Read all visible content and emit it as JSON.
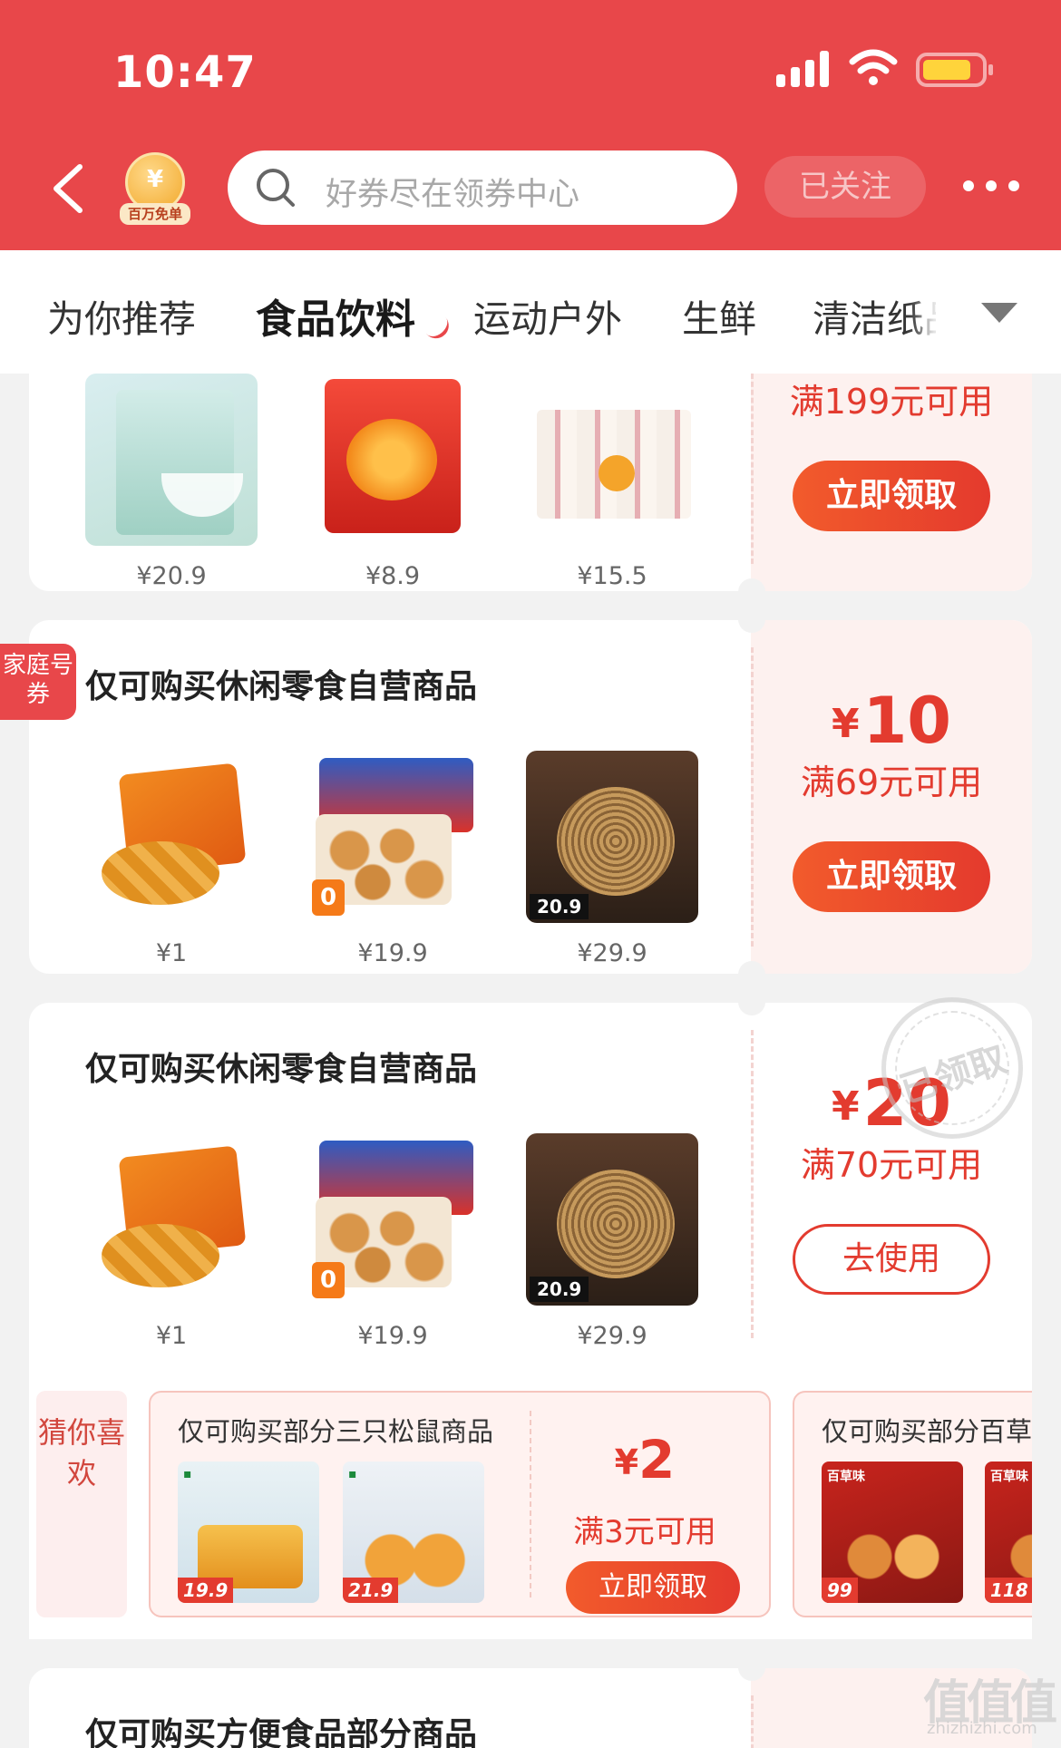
{
  "status_bar": {
    "time": "10:47"
  },
  "header": {
    "free_badge_text": "百万免单",
    "search_placeholder": "好券尽在领券中心",
    "follow_label": "已关注"
  },
  "tabs": [
    {
      "label": "为你推荐",
      "active": false
    },
    {
      "label": "食品饮料",
      "active": true
    },
    {
      "label": "运动户外",
      "active": false
    },
    {
      "label": "生鲜",
      "active": false
    },
    {
      "label": "清洁纸品",
      "active": false
    }
  ],
  "family_tag": "家庭号券",
  "cards": [
    {
      "title": "",
      "amount_currency": "",
      "amount": "",
      "condition": "满199元可用",
      "button": "立即领取",
      "products": [
        {
          "name": "白凉粉",
          "price": "¥20.9"
        },
        {
          "name": "果汁果冻",
          "price": "¥8.9"
        },
        {
          "name": "吸吸果冻",
          "price": "¥15.5"
        }
      ]
    },
    {
      "title": "仅可购买休闲零食自营商品",
      "amount_currency": "¥",
      "amount": "10",
      "condition": "满69元可用",
      "button": "立即领取",
      "products": [
        {
          "name": "薯片",
          "price": "¥1"
        },
        {
          "name": "小圆饼干",
          "price": "¥19.9"
        },
        {
          "name": "拌面",
          "price": "¥29.9"
        }
      ]
    },
    {
      "title": "仅可购买休闲零食自营商品",
      "amount_currency": "¥",
      "amount": "20",
      "condition": "满70元可用",
      "button": "去使用",
      "stamp": "已领取",
      "products": [
        {
          "name": "薯片",
          "price": "¥1"
        },
        {
          "name": "小圆饼干",
          "price": "¥19.9"
        },
        {
          "name": "拌面",
          "price": "¥29.9"
        }
      ]
    },
    {
      "title": "仅可购买方便食品部分商品"
    }
  ],
  "guess": {
    "label": "猜你喜欢",
    "items": [
      {
        "title": "仅可购买部分三只松鼠商品",
        "amount_currency": "¥",
        "amount": "2",
        "condition": "满3元可用",
        "button": "立即领取",
        "pics": [
          {
            "price_tag": "19.9"
          },
          {
            "price_tag": "21.9"
          }
        ]
      },
      {
        "title": "仅可购买部分百草味商品",
        "pics": [
          {
            "brand": "百草味",
            "price_tag": "99"
          },
          {
            "brand": "百草味",
            "price_tag": "118"
          }
        ]
      }
    ]
  },
  "watermark": {
    "logo": "值值值",
    "url": "zhizhizhi.com"
  }
}
